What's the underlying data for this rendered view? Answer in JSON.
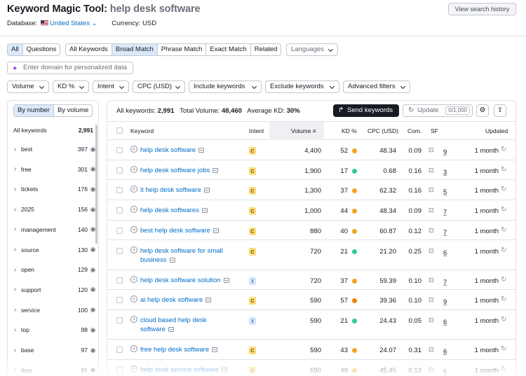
{
  "header": {
    "title_prefix": "Keyword Magic Tool:",
    "query": "help desk software",
    "history_button": "View search history",
    "database_label": "Database:",
    "database_value": "United States",
    "currency": "Currency: USD"
  },
  "match_tabs": {
    "group1": [
      "All",
      "Questions"
    ],
    "group2": [
      "All Keywords",
      "Broad Match",
      "Phrase Match",
      "Exact Match",
      "Related"
    ],
    "languages": "Languages"
  },
  "domain_input": {
    "placeholder": "Enter domain for personalized data"
  },
  "filters": [
    "Volume",
    "KD %",
    "Intent",
    "CPC (USD)",
    "Include keywords",
    "Exclude keywords",
    "Advanced filters"
  ],
  "sidebar": {
    "tabs": [
      "By number",
      "By volume"
    ],
    "all_label": "All keywords",
    "all_count": "2,991",
    "items": [
      {
        "name": "best",
        "count": "397"
      },
      {
        "name": "free",
        "count": "301"
      },
      {
        "name": "tickets",
        "count": "176"
      },
      {
        "name": "2025",
        "count": "156"
      },
      {
        "name": "management",
        "count": "140"
      },
      {
        "name": "source",
        "count": "130"
      },
      {
        "name": "open",
        "count": "129"
      },
      {
        "name": "support",
        "count": "120"
      },
      {
        "name": "service",
        "count": "100"
      },
      {
        "name": "top",
        "count": "98"
      },
      {
        "name": "base",
        "count": "97"
      },
      {
        "name": "itsm",
        "count": "91"
      }
    ]
  },
  "summary": {
    "all_keywords_label": "All keywords:",
    "all_keywords": "2,991",
    "total_volume_label": "Total Volume:",
    "total_volume": "48,460",
    "avg_kd_label": "Average KD:",
    "avg_kd": "30%",
    "send_button": "Send keywords",
    "update_button": "Update",
    "update_count": "0/1,000"
  },
  "columns": {
    "keyword": "Keyword",
    "intent": "Intent",
    "volume": "Volume",
    "kd": "KD %",
    "cpc": "CPC (USD)",
    "com": "Com.",
    "sf": "SF",
    "updated": "Updated"
  },
  "colors": {
    "kd_orange": "#f0a51c",
    "kd_green": "#36c98e",
    "kd_darkorange": "#e9830a"
  },
  "rows": [
    {
      "keyword": "help desk software",
      "line2": "",
      "intent": "C",
      "volume": "4,400",
      "kd": "52",
      "kd_color": "#f0a51c",
      "cpc": "48.34",
      "com": "0.09",
      "sf": "9",
      "updated": "1 month"
    },
    {
      "keyword": "help desk software jobs",
      "line2": "",
      "intent": "C",
      "volume": "1,900",
      "kd": "17",
      "kd_color": "#36c98e",
      "cpc": "0.68",
      "com": "0.16",
      "sf": "3",
      "updated": "1 month"
    },
    {
      "keyword": "it help desk software",
      "line2": "",
      "intent": "C",
      "volume": "1,300",
      "kd": "37",
      "kd_color": "#f0a51c",
      "cpc": "62.32",
      "com": "0.16",
      "sf": "5",
      "updated": "1 month"
    },
    {
      "keyword": "help desk softwares",
      "line2": "",
      "intent": "C",
      "volume": "1,000",
      "kd": "44",
      "kd_color": "#f0a51c",
      "cpc": "48.34",
      "com": "0.09",
      "sf": "7",
      "updated": "1 month"
    },
    {
      "keyword": "best help desk software",
      "line2": "",
      "intent": "C",
      "volume": "880",
      "kd": "40",
      "kd_color": "#f0a51c",
      "cpc": "60.87",
      "com": "0.12",
      "sf": "7",
      "updated": "1 month"
    },
    {
      "keyword": "help desk software for small",
      "line2": "business",
      "intent": "C",
      "volume": "720",
      "kd": "21",
      "kd_color": "#36c98e",
      "cpc": "21.20",
      "com": "0.25",
      "sf": "6",
      "updated": "1 month"
    },
    {
      "keyword": "help desk software solution",
      "line2": "",
      "intent": "I",
      "volume": "720",
      "kd": "37",
      "kd_color": "#f0a51c",
      "cpc": "59.39",
      "com": "0.10",
      "sf": "7",
      "updated": "1 month"
    },
    {
      "keyword": "ai help desk software",
      "line2": "",
      "intent": "C",
      "volume": "590",
      "kd": "57",
      "kd_color": "#e9830a",
      "cpc": "39.36",
      "com": "0.10",
      "sf": "9",
      "updated": "1 month"
    },
    {
      "keyword": "cloud based help desk",
      "line2": "software",
      "intent": "I",
      "volume": "590",
      "kd": "21",
      "kd_color": "#36c98e",
      "cpc": "24.43",
      "com": "0.05",
      "sf": "6",
      "updated": "1 month"
    },
    {
      "keyword": "free help desk software",
      "line2": "",
      "intent": "C",
      "volume": "590",
      "kd": "43",
      "kd_color": "#f0a51c",
      "cpc": "24.07",
      "com": "0.31",
      "sf": "6",
      "updated": "1 month"
    },
    {
      "keyword": "help desk service software",
      "line2": "",
      "intent": "C",
      "volume": "590",
      "kd": "49",
      "kd_color": "#f0a51c",
      "cpc": "45.45",
      "com": "0.12",
      "sf": "5",
      "updated": "1 month"
    }
  ]
}
